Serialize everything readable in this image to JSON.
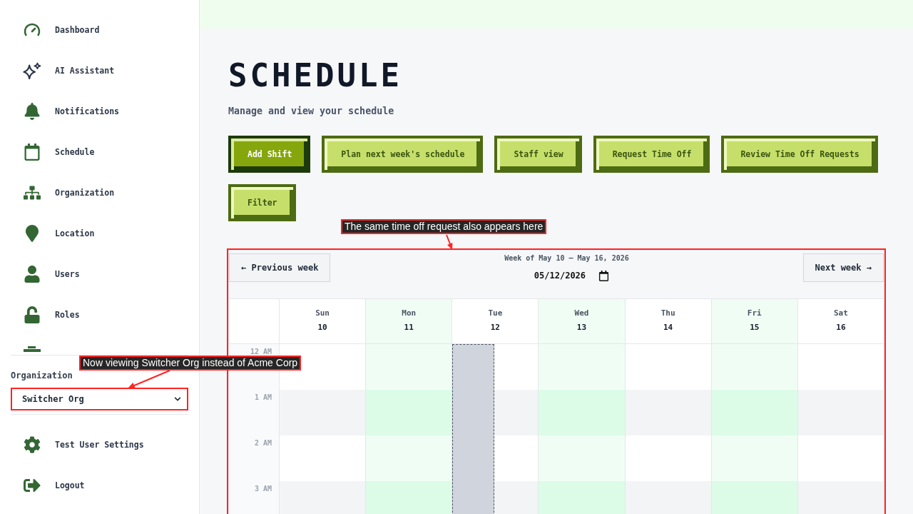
{
  "sidebar": {
    "nav_items": [
      {
        "label": "Dashboard"
      },
      {
        "label": "AI Assistant"
      },
      {
        "label": "Notifications"
      },
      {
        "label": "Schedule"
      },
      {
        "label": "Organization"
      },
      {
        "label": "Location"
      },
      {
        "label": "Users"
      },
      {
        "label": "Roles"
      }
    ],
    "organization": {
      "label": "Organization",
      "value": "Switcher Org",
      "annotation": "Now viewing Switcher Org instead of Acme Corp"
    },
    "footer_items": [
      {
        "label": "Test User Settings"
      },
      {
        "label": "Logout"
      }
    ]
  },
  "header": {
    "title": "SCHEDULE",
    "subtitle": "Manage and view your schedule"
  },
  "actions": [
    {
      "label": "Add Shift",
      "primary": true
    },
    {
      "label": "Plan next week's schedule",
      "primary": false
    },
    {
      "label": "Staff view",
      "primary": false
    },
    {
      "label": "Request Time Off",
      "primary": false
    },
    {
      "label": "Review Time Off Requests",
      "primary": false
    },
    {
      "label": "Filter",
      "primary": false
    }
  ],
  "calendar": {
    "annotation": "The same time off request also appears here",
    "previous_button": "← Previous week",
    "week_label": "Week of May 10 – May 16, 2026",
    "date": "05/12/2026",
    "next_button": "Next week →",
    "days": [
      {
        "name": "Sun",
        "date": "10",
        "highlighted": false,
        "time_off": false
      },
      {
        "name": "Mon",
        "date": "11",
        "highlighted": true,
        "time_off": false
      },
      {
        "name": "Tue",
        "date": "12",
        "highlighted": false,
        "time_off": true
      },
      {
        "name": "Wed",
        "date": "13",
        "highlighted": true,
        "time_off": false
      },
      {
        "name": "Thu",
        "date": "14",
        "highlighted": false,
        "time_off": false
      },
      {
        "name": "Fri",
        "date": "15",
        "highlighted": true,
        "time_off": false
      },
      {
        "name": "Sat",
        "date": "16",
        "highlighted": false,
        "time_off": false
      }
    ],
    "hours": [
      "12 AM",
      "1 AM",
      "2 AM",
      "3 AM"
    ]
  }
}
